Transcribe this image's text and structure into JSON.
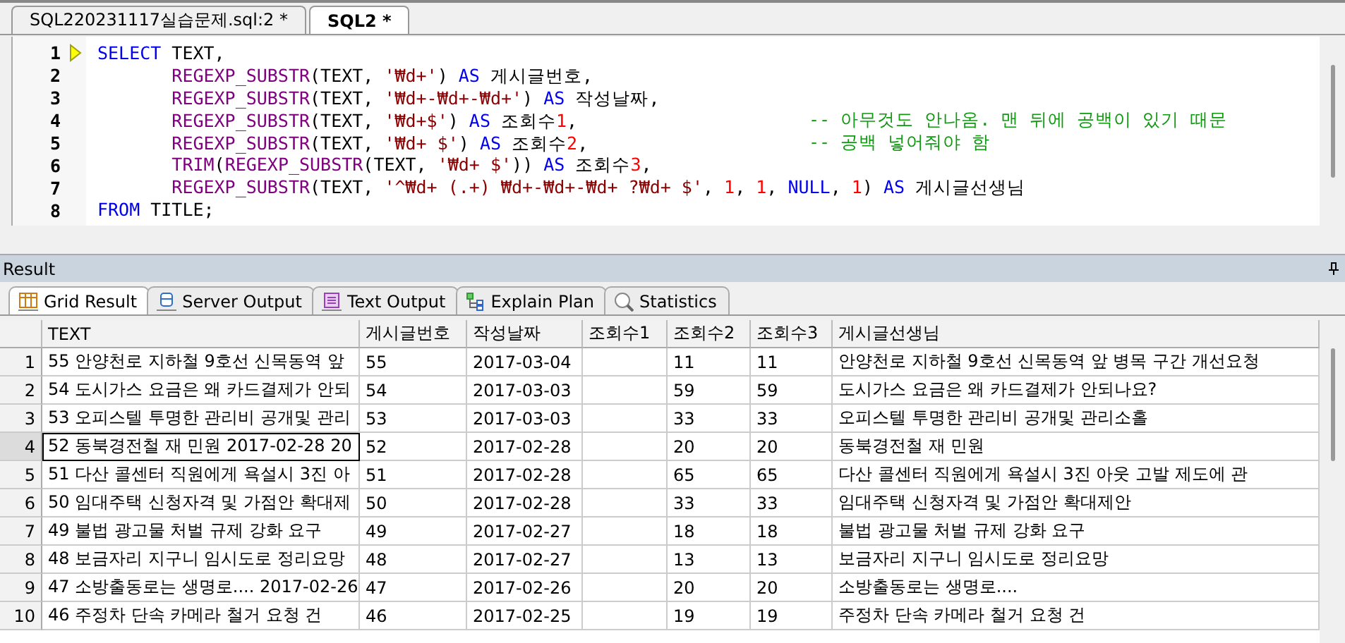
{
  "editor_tabs": [
    {
      "label": "SQL220231117실습문제.sql:2 *",
      "selected": false
    },
    {
      "label": "SQL2 *",
      "selected": true
    }
  ],
  "editor": {
    "lines": [
      {
        "number": "1",
        "current": true,
        "tokens": [
          {
            "kind": "keyword",
            "text": "SELECT"
          },
          {
            "kind": "plain",
            "text": " TEXT,"
          }
        ]
      },
      {
        "number": "2",
        "current": false,
        "tokens": [
          {
            "kind": "function",
            "text": "       REGEXP_SUBSTR"
          },
          {
            "kind": "plain",
            "text": "(TEXT, "
          },
          {
            "kind": "string",
            "text": "'₩d+'"
          },
          {
            "kind": "plain",
            "text": ") "
          },
          {
            "kind": "keyword",
            "text": "AS"
          },
          {
            "kind": "plain",
            "text": " 게시글번호,"
          }
        ]
      },
      {
        "number": "3",
        "current": false,
        "tokens": [
          {
            "kind": "function",
            "text": "       REGEXP_SUBSTR"
          },
          {
            "kind": "plain",
            "text": "(TEXT, "
          },
          {
            "kind": "string",
            "text": "'₩d+-₩d+-₩d+'"
          },
          {
            "kind": "plain",
            "text": ") "
          },
          {
            "kind": "keyword",
            "text": "AS"
          },
          {
            "kind": "plain",
            "text": " 작성날짜,"
          }
        ]
      },
      {
        "number": "4",
        "current": false,
        "comment": "-- 아무것도 안나옴. 맨 뒤에 공백이 있기 때문",
        "tokens": [
          {
            "kind": "function",
            "text": "       REGEXP_SUBSTR"
          },
          {
            "kind": "plain",
            "text": "(TEXT, "
          },
          {
            "kind": "string",
            "text": "'₩d+$'"
          },
          {
            "kind": "plain",
            "text": ") "
          },
          {
            "kind": "keyword",
            "text": "AS"
          },
          {
            "kind": "plain",
            "text": " 조회수"
          },
          {
            "kind": "number",
            "text": "1"
          },
          {
            "kind": "plain",
            "text": ","
          }
        ]
      },
      {
        "number": "5",
        "current": false,
        "comment": "-- 공백 넣어줘야 함",
        "tokens": [
          {
            "kind": "function",
            "text": "       REGEXP_SUBSTR"
          },
          {
            "kind": "plain",
            "text": "(TEXT, "
          },
          {
            "kind": "string",
            "text": "'₩d+ $'"
          },
          {
            "kind": "plain",
            "text": ") "
          },
          {
            "kind": "keyword",
            "text": "AS"
          },
          {
            "kind": "plain",
            "text": " 조회수"
          },
          {
            "kind": "number",
            "text": "2"
          },
          {
            "kind": "plain",
            "text": ","
          }
        ]
      },
      {
        "number": "6",
        "current": false,
        "tokens": [
          {
            "kind": "function",
            "text": "       TRIM"
          },
          {
            "kind": "plain",
            "text": "("
          },
          {
            "kind": "function",
            "text": "REGEXP_SUBSTR"
          },
          {
            "kind": "plain",
            "text": "(TEXT, "
          },
          {
            "kind": "string",
            "text": "'₩d+ $'"
          },
          {
            "kind": "plain",
            "text": ")) "
          },
          {
            "kind": "keyword",
            "text": "AS"
          },
          {
            "kind": "plain",
            "text": " 조회수"
          },
          {
            "kind": "number",
            "text": "3"
          },
          {
            "kind": "plain",
            "text": ","
          }
        ]
      },
      {
        "number": "7",
        "current": false,
        "tokens": [
          {
            "kind": "function",
            "text": "       REGEXP_SUBSTR"
          },
          {
            "kind": "plain",
            "text": "(TEXT, "
          },
          {
            "kind": "string",
            "text": "'^₩d+ (.+) ₩d+-₩d+-₩d+ ?₩d+ $'"
          },
          {
            "kind": "plain",
            "text": ", "
          },
          {
            "kind": "number",
            "text": "1"
          },
          {
            "kind": "plain",
            "text": ", "
          },
          {
            "kind": "number",
            "text": "1"
          },
          {
            "kind": "plain",
            "text": ", "
          },
          {
            "kind": "keyword",
            "text": "NULL"
          },
          {
            "kind": "plain",
            "text": ", "
          },
          {
            "kind": "number",
            "text": "1"
          },
          {
            "kind": "plain",
            "text": ") "
          },
          {
            "kind": "keyword",
            "text": "AS"
          },
          {
            "kind": "plain",
            "text": " 게시글선생님"
          }
        ]
      },
      {
        "number": "8",
        "current": false,
        "tokens": [
          {
            "kind": "keyword",
            "text": "FROM"
          },
          {
            "kind": "plain",
            "text": " TITLE;"
          }
        ]
      }
    ]
  },
  "result": {
    "title": "Result",
    "tabs": [
      {
        "label": "Grid Result",
        "selected": true
      },
      {
        "label": "Server Output",
        "selected": false
      },
      {
        "label": "Text Output",
        "selected": false
      },
      {
        "label": "Explain Plan",
        "selected": false
      },
      {
        "label": "Statistics",
        "selected": false
      }
    ],
    "columns": [
      "TEXT",
      "게시글번호",
      "작성날짜",
      "조회수1",
      "조회수2",
      "조회수3",
      "게시글선생님"
    ],
    "rows": [
      {
        "number": "1",
        "selected": false,
        "cells": [
          "55 안양천로 지하철 9호선 신목동역 앞",
          "55",
          "2017-03-04",
          "",
          "11",
          "11",
          "안양천로 지하철 9호선 신목동역 앞 병목 구간 개선요청"
        ]
      },
      {
        "number": "2",
        "selected": false,
        "cells": [
          "54 도시가스 요금은 왜 카드결제가 안되",
          "54",
          "2017-03-03",
          "",
          "59",
          "59",
          "도시가스 요금은 왜 카드결제가 안되나요?"
        ]
      },
      {
        "number": "3",
        "selected": false,
        "cells": [
          "53 오피스텔 투명한 관리비 공개및 관리",
          "53",
          "2017-03-03",
          "",
          "33",
          "33",
          "오피스텔 투명한 관리비 공개및 관리소홀"
        ]
      },
      {
        "number": "4",
        "selected": true,
        "cells": [
          "52 동북경전철 재 민원 2017-02-28 20",
          "52",
          "2017-02-28",
          "",
          "20",
          "20",
          "동북경전철 재 민원"
        ]
      },
      {
        "number": "5",
        "selected": false,
        "cells": [
          "51 다산 콜센터 직원에게 욕설시 3진 아",
          "51",
          "2017-02-28",
          "",
          "65",
          "65",
          "다산 콜센터 직원에게 욕설시 3진 아웃 고발 제도에 관"
        ]
      },
      {
        "number": "6",
        "selected": false,
        "cells": [
          "50 임대주택 신청자격 및 가점안 확대제",
          "50",
          "2017-02-28",
          "",
          "33",
          "33",
          "임대주택 신청자격 및 가점안 확대제안"
        ]
      },
      {
        "number": "7",
        "selected": false,
        "cells": [
          "49 불법 광고물 처벌 규제 강화 요구",
          "49",
          "2017-02-27",
          "",
          "18",
          "18",
          "불법 광고물 처벌 규제 강화 요구"
        ]
      },
      {
        "number": "8",
        "selected": false,
        "cells": [
          "48 보금자리 지구니 임시도로 정리요망",
          "48",
          "2017-02-27",
          "",
          "13",
          "13",
          "보금자리 지구니 임시도로 정리요망"
        ]
      },
      {
        "number": "9",
        "selected": false,
        "cells": [
          "47 소방출동로는 생명로.... 2017-02-26",
          "47",
          "2017-02-26",
          "",
          "20",
          "20",
          "소방출동로는 생명로...."
        ]
      },
      {
        "number": "10",
        "selected": false,
        "cells": [
          "46 주정차 단속 카메라 철거 요청 건",
          "46",
          "2017-02-25",
          "",
          "19",
          "19",
          "주정차 단속 카메라 철거 요청 건"
        ]
      }
    ]
  }
}
